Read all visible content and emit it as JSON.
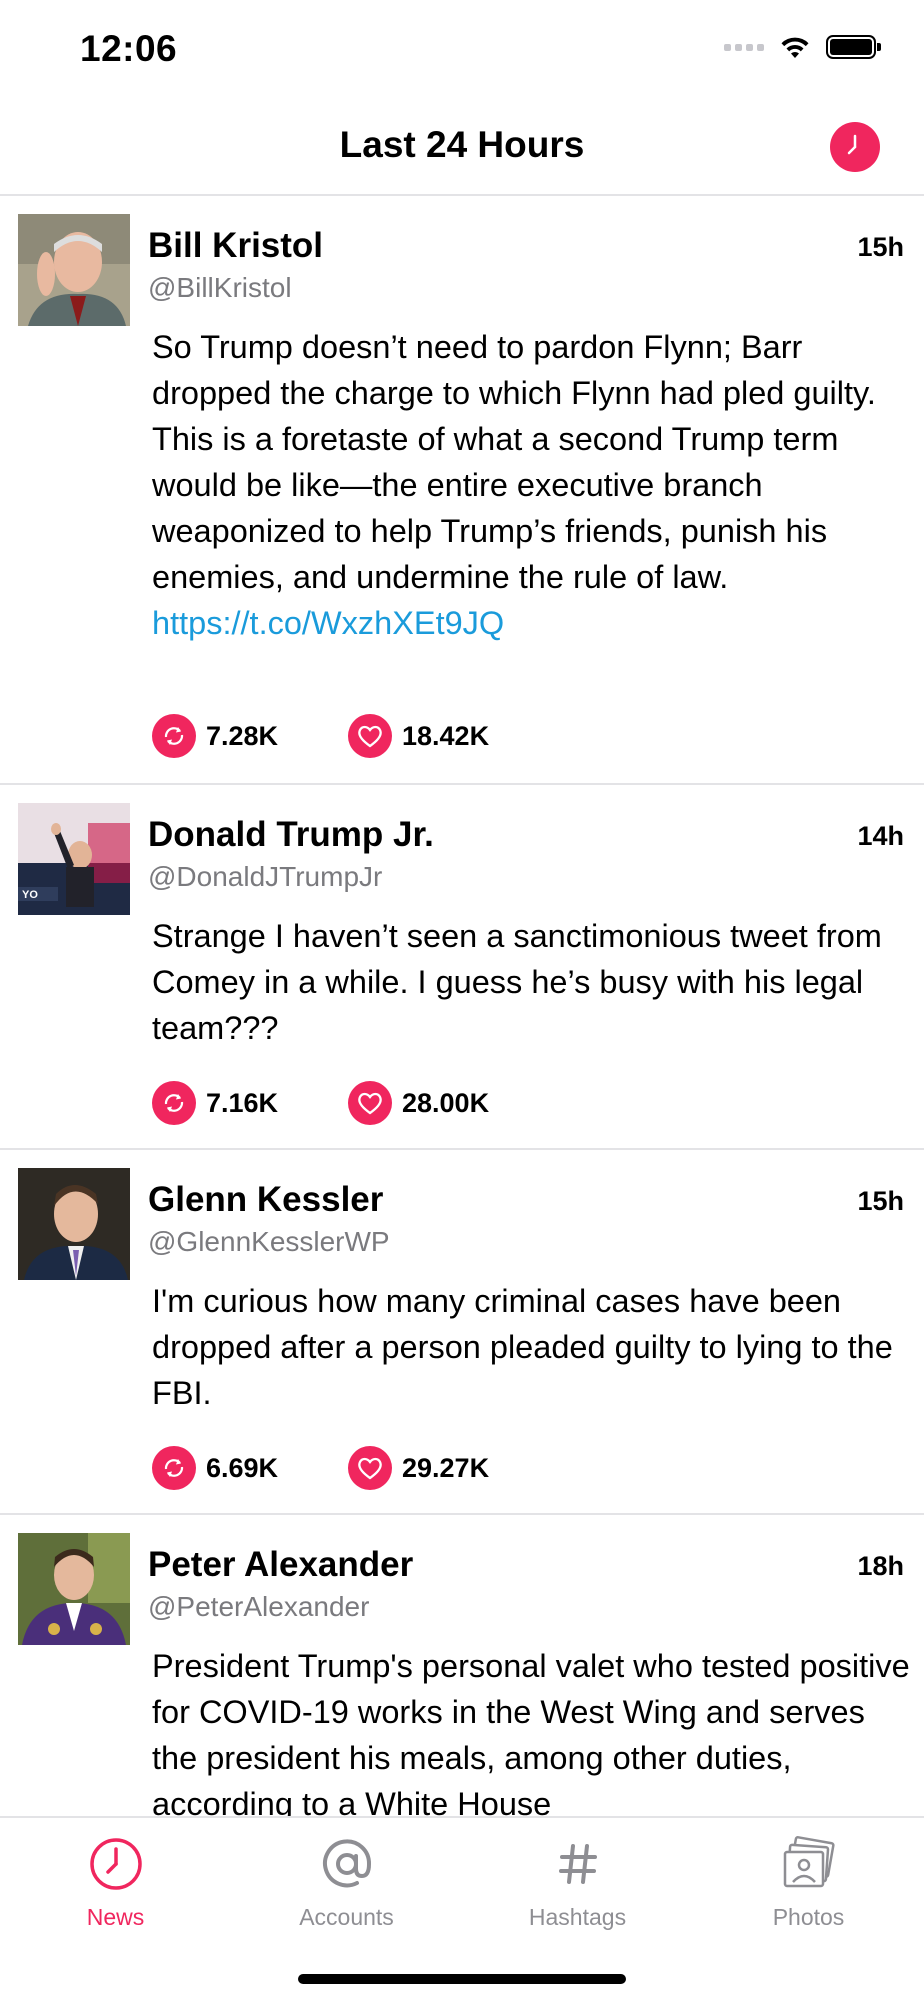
{
  "status_bar": {
    "time": "12:06"
  },
  "navbar": {
    "title": "Last 24 Hours",
    "action_icon": "clock-icon"
  },
  "colors": {
    "accent": "#f0265e",
    "link": "#1a9bdb",
    "separator": "#e3e3e6",
    "muted": "#8e8e93"
  },
  "tweets": [
    {
      "name": "Bill Kristol",
      "handle": "@BillKristol",
      "age": "15h",
      "text": "So Trump doesn’t need to pardon Flynn; Barr dropped the charge to which Flynn had pled guilty. This is a foretaste of what a second Trump term would be like—the entire executive branch weaponized to help  Trump’s friends, punish his enemies, and undermine the rule of law.",
      "link": "https://t.co/WxzhXEt9JQ",
      "retweets": "7.28K",
      "likes": "18.42K"
    },
    {
      "name": "Donald Trump Jr.",
      "handle": "@DonaldJTrumpJr",
      "age": "14h",
      "text": "Strange I haven’t seen a sanctimonious tweet from Comey in a while. I guess he’s busy with his legal team???",
      "retweets": "7.16K",
      "likes": "28.00K"
    },
    {
      "name": "Glenn Kessler",
      "handle": "@GlennKesslerWP",
      "age": "15h",
      "text": "I'm curious how many criminal cases have been dropped after a person pleaded guilty to lying to the FBI.",
      "retweets": "6.69K",
      "likes": "29.27K"
    },
    {
      "name": "Peter Alexander",
      "handle": "@PeterAlexander",
      "age": "18h",
      "text": "President Trump's personal valet who tested positive for COVID-19 works in the West Wing and serves the president his meals, among other duties, according to a White House"
    }
  ],
  "tabs": [
    {
      "label": "News",
      "icon": "clock-icon",
      "active": true
    },
    {
      "label": "Accounts",
      "icon": "at-sign-icon",
      "active": false
    },
    {
      "label": "Hashtags",
      "icon": "hashtag-icon",
      "active": false
    },
    {
      "label": "Photos",
      "icon": "photos-icon",
      "active": false
    }
  ]
}
